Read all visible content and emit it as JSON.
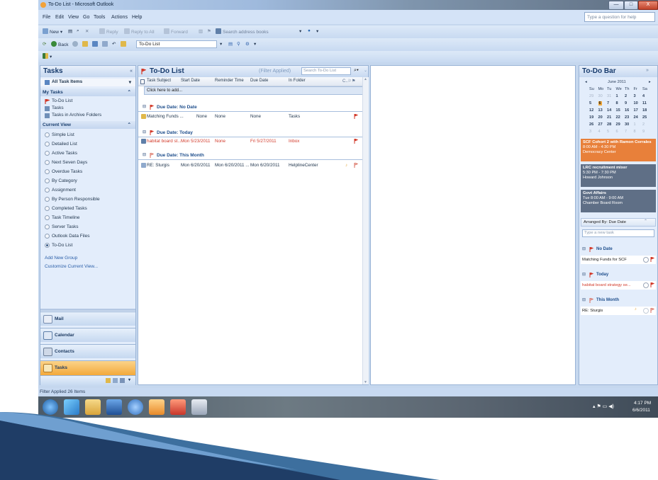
{
  "window": {
    "title": "To-Do List - Microsoft Outlook",
    "controls": [
      "—",
      "□",
      "X"
    ]
  },
  "menu": {
    "items": [
      "File",
      "Edit",
      "View",
      "Go",
      "Tools",
      "Actions",
      "Help"
    ],
    "help_placeholder": "Type a question for help"
  },
  "toolbar1": {
    "new": "New",
    "reply": "Reply",
    "reply_all": "Reply to All",
    "forward": "Forward",
    "search_books": "Search address books"
  },
  "toolbar2": {
    "back": "Back",
    "location": "To-Do List"
  },
  "tasks_pane": {
    "title": "Tasks",
    "all_items": "All Task Items",
    "my_tasks_header": "My Tasks",
    "my_tasks": [
      "To-Do List",
      "Tasks",
      "Tasks in Archive Folders"
    ],
    "current_view_header": "Current View",
    "views": [
      "Simple List",
      "Detailed List",
      "Active Tasks",
      "Next Seven Days",
      "Overdue Tasks",
      "By Category",
      "Assignment",
      "By Person Responsible",
      "Completed Tasks",
      "Task Timeline",
      "Server Tasks",
      "Outlook Data Files",
      "To-Do List"
    ],
    "selected_view": "To-Do List",
    "links": [
      "Add New Group",
      "Customize Current View..."
    ],
    "nav": [
      "Mail",
      "Calendar",
      "Contacts",
      "Tasks"
    ],
    "active_nav": "Tasks"
  },
  "todo_list": {
    "title": "To-Do List",
    "filter_note": "(Filter Applied)",
    "search_placeholder": "Search To-Do List",
    "columns": [
      "Task Subject",
      "Start Date",
      "Reminder Time",
      "Due Date",
      "In Folder"
    ],
    "new_item_placeholder": "Click here to add...",
    "groups": [
      {
        "label": "Due Date: No Date",
        "rows": [
          {
            "subject": "Matching Funds ...",
            "start": "None",
            "reminder": "None",
            "due": "None",
            "folder": "Tasks",
            "overdue": false
          }
        ]
      },
      {
        "label": "Due Date: Today",
        "rows": [
          {
            "subject": "habitat board st...",
            "start": "Mon 5/23/2011",
            "reminder": "None",
            "due": "Fri 5/27/2011",
            "folder": "Inbox",
            "overdue": true
          }
        ]
      },
      {
        "label": "Due Date: This Month",
        "rows": [
          {
            "subject": "RE: Sturgis",
            "start": "Mon 6/20/2011",
            "reminder": "Mon 6/20/2011 ...",
            "due": "Mon 6/20/2011",
            "folder": "HelplineCenter",
            "overdue": false
          }
        ]
      }
    ]
  },
  "todo_bar": {
    "title": "To-Do Bar",
    "month": "June 2011",
    "weekdays": [
      "Su",
      "Mo",
      "Tu",
      "We",
      "Th",
      "Fr",
      "Sa"
    ],
    "weeks": [
      [
        "29",
        "30",
        "31",
        "1",
        "2",
        "3",
        "4"
      ],
      [
        "5",
        "6",
        "7",
        "8",
        "9",
        "10",
        "11"
      ],
      [
        "12",
        "13",
        "14",
        "15",
        "16",
        "17",
        "18"
      ],
      [
        "19",
        "20",
        "21",
        "22",
        "23",
        "24",
        "25"
      ],
      [
        "26",
        "27",
        "28",
        "29",
        "30",
        "1",
        "2"
      ],
      [
        "3",
        "4",
        "5",
        "6",
        "7",
        "8",
        "9"
      ]
    ],
    "today": "6",
    "appointments": [
      {
        "title": "SCF Cohort 2 with Ramon Corrales",
        "time": "8:00 AM - 4:30 PM",
        "location": "Democracy Center",
        "color": "#e8803a"
      },
      {
        "title": "LRC recruitment mixer",
        "time": "5:30 PM - 7:30 PM",
        "location": "Howard Johnson",
        "color": "#5f6f86"
      },
      {
        "title": "Govt Affairs",
        "time": "Tue 8:00 AM - 9:00 AM",
        "location": "Chamber Board Room",
        "color": "#5f6f86"
      }
    ],
    "arranged_by": "Arranged By: Due Date",
    "new_task_placeholder": "Type a new task",
    "groups": [
      {
        "label": "No Date",
        "item": "Matching Funds for SCF",
        "overdue": false
      },
      {
        "label": "Today",
        "item": "habitat board strategy se...",
        "overdue": true
      },
      {
        "label": "This Month",
        "item": "RE: Sturgis",
        "overdue": false
      }
    ]
  },
  "status": {
    "text": "Filter Applied   26 Items"
  },
  "taskbar": {
    "time": "4:17 PM",
    "date": "6/6/2011"
  },
  "colors": {
    "overdue": "#d23a2a",
    "accent": "#163a6c",
    "active_nav": "#f3a93a"
  }
}
